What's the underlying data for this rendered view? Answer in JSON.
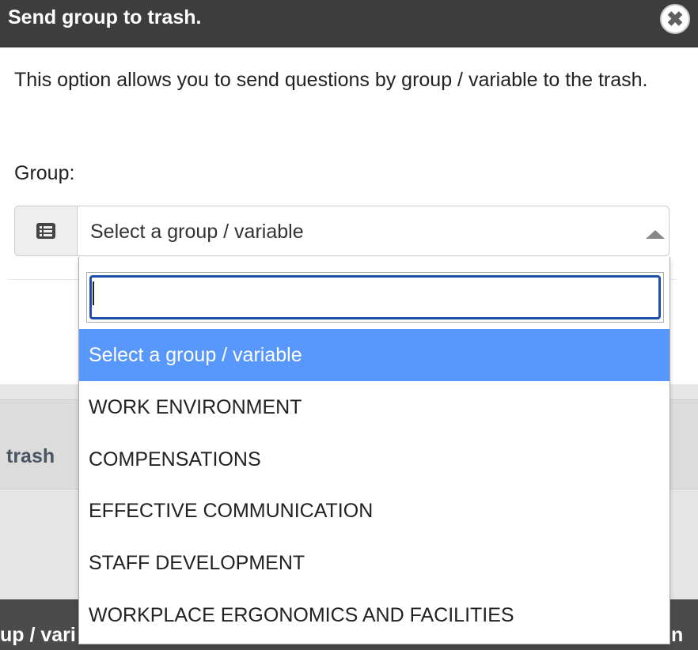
{
  "modal": {
    "title": "Send group to trash.",
    "description": "This option allows you to send questions by group / variable to the trash.",
    "group_label": "Group:",
    "select_value": "Select a group / variable"
  },
  "dropdown": {
    "search_value": "",
    "options": [
      "Select a group / variable",
      "WORK ENVIRONMENT",
      "COMPENSATIONS",
      "EFFECTIVE COMMUNICATION",
      "STAFF DEVELOPMENT",
      "WORKPLACE ERGONOMICS AND FACILITIES"
    ],
    "highlighted_index": 0
  },
  "background": {
    "trash_text": "trash",
    "footer_left": "up / vari",
    "footer_right": "n"
  },
  "colors": {
    "header": "#3d3d3d",
    "highlight": "#5897fb",
    "focus_border": "#1e4fa8"
  },
  "icons": {
    "close": "close-icon",
    "list": "list-icon",
    "arrow": "arrow-up-icon"
  }
}
